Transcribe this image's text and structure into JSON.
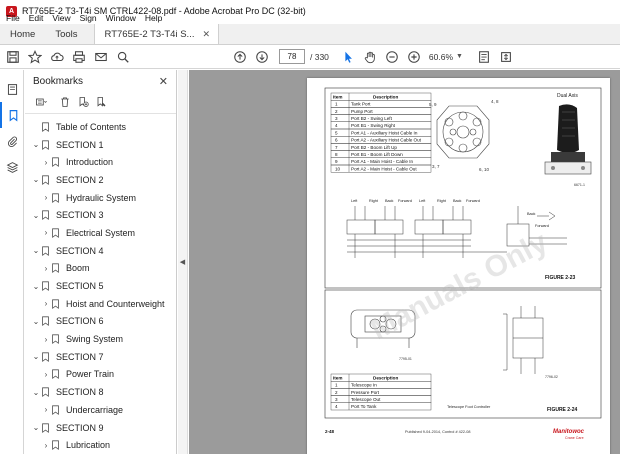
{
  "window": {
    "title": "RT765E-2 T3-T4i SM CTRL422-08.pdf - Adobe Acrobat Pro DC (32-bit)"
  },
  "menu": [
    "File",
    "Edit",
    "View",
    "Sign",
    "Window",
    "Help"
  ],
  "tabs": {
    "home": "Home",
    "tools": "Tools",
    "doc": "RT765E-2 T3-T4i S..."
  },
  "toolbar": {
    "page_current": "78",
    "page_total": "/ 330",
    "zoom": "60.6%"
  },
  "bookmarks": {
    "title": "Bookmarks",
    "items": [
      {
        "label": "Table of Contents",
        "level": 0,
        "caret": false
      },
      {
        "label": "SECTION 1",
        "level": 0,
        "caret": true
      },
      {
        "label": "Introduction",
        "level": 1,
        "caret": true
      },
      {
        "label": "SECTION 2",
        "level": 0,
        "caret": true
      },
      {
        "label": "Hydraulic System",
        "level": 1,
        "caret": true
      },
      {
        "label": "SECTION 3",
        "level": 0,
        "caret": true
      },
      {
        "label": "Electrical System",
        "level": 1,
        "caret": true
      },
      {
        "label": "SECTION 4",
        "level": 0,
        "caret": true
      },
      {
        "label": "Boom",
        "level": 1,
        "caret": true
      },
      {
        "label": "SECTION 5",
        "level": 0,
        "caret": true
      },
      {
        "label": "Hoist and Counterweight",
        "level": 1,
        "caret": true
      },
      {
        "label": "SECTION 6",
        "level": 0,
        "caret": true
      },
      {
        "label": "Swing System",
        "level": 1,
        "caret": true
      },
      {
        "label": "SECTION 7",
        "level": 0,
        "caret": true
      },
      {
        "label": "Power Train",
        "level": 1,
        "caret": true
      },
      {
        "label": "SECTION 8",
        "level": 0,
        "caret": true
      },
      {
        "label": "Undercarriage",
        "level": 1,
        "caret": true
      },
      {
        "label": "SECTION 9",
        "level": 0,
        "caret": true
      },
      {
        "label": "Lubrication",
        "level": 1,
        "caret": true
      }
    ]
  },
  "document": {
    "table1": {
      "headers": [
        "Item",
        "Description"
      ],
      "rows": [
        [
          "1",
          "Tank Port"
        ],
        [
          "2",
          "Pump Port"
        ],
        [
          "3",
          "Port B2 - Swing Left"
        ],
        [
          "4",
          "Port B1 - Swing Right"
        ],
        [
          "5",
          "Port A1 - Auxiliary Hoist Cable In"
        ],
        [
          "6",
          "Port A2 - Auxiliary Hoist Cable Out"
        ],
        [
          "7",
          "Port B2 - Boom Lift Up"
        ],
        [
          "8",
          "Port B1 - Boom Lift Down"
        ],
        [
          "9",
          "Port A1 - Main Hoist - Cable In"
        ],
        [
          "10",
          "Port A2 - Main Hoist - Cable Out"
        ]
      ]
    },
    "dual_axis_label": "Dual Axis",
    "schematic_labels": [
      "Left",
      "Right",
      "Back",
      "Forward",
      "Left",
      "Right",
      "Back",
      "Forward"
    ],
    "back_label": "Back",
    "forward_label": "Forward",
    "figure1": "FIGURE 2-23",
    "figure2": "FIGURE 2-24",
    "table2": {
      "headers": [
        "Item",
        "Description"
      ],
      "rows": [
        [
          "1",
          "Telescope In"
        ],
        [
          "2",
          "Pressure Port"
        ],
        [
          "3",
          "Telescope Out"
        ],
        [
          "4",
          "Port To Tank"
        ]
      ]
    },
    "telescope_caption": "Telescope Foot Controller",
    "footer_page": "2-48",
    "footer_pub": "Published 9-04-2014, Control # 422-08",
    "brand": "Manitowoc",
    "brand_sub": "Crane Care",
    "watermark": "Manuals Only"
  }
}
